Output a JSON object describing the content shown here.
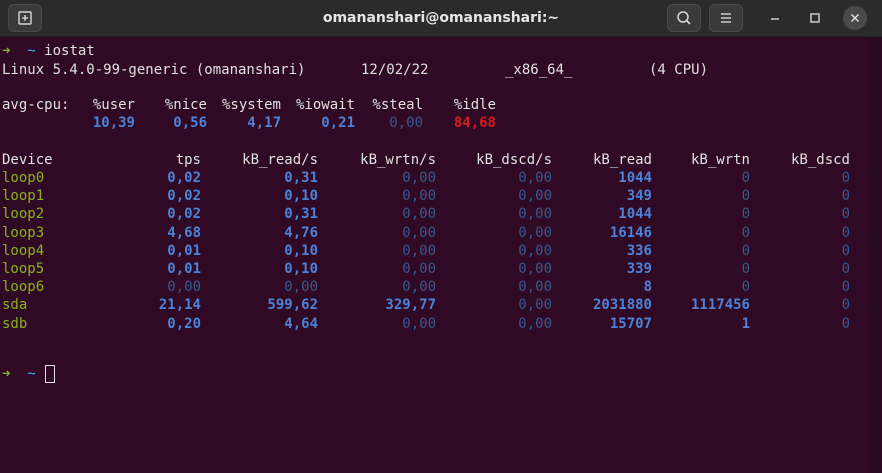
{
  "window": {
    "title": "omananshari@omananshari:~",
    "icons": [
      "new-tab-icon",
      "search-icon",
      "hamburger-menu-icon",
      "minimize-icon",
      "maximize-icon",
      "close-icon"
    ]
  },
  "terminal": {
    "prompt": {
      "arrow": "➜",
      "cwd": "~"
    },
    "command": "iostat",
    "sysinfo": {
      "kernel": "Linux 5.4.0-99-generic (omananshari)",
      "date": "12/02/22",
      "arch": "_x86_64_",
      "cpus": "(4 CPU)"
    },
    "cpu": {
      "label": "avg-cpu:",
      "headers": [
        "%user",
        "%nice",
        "%system",
        "%iowait",
        "%steal",
        "%idle"
      ],
      "values": [
        "10,39",
        "0,56",
        "4,17",
        "0,21",
        "0,00",
        "84,68"
      ]
    },
    "devices": {
      "headers": [
        "Device",
        "tps",
        "kB_read/s",
        "kB_wrtn/s",
        "kB_dscd/s",
        "kB_read",
        "kB_wrtn",
        "kB_dscd"
      ],
      "rows": [
        [
          "loop0",
          "0,02",
          "0,31",
          "0,00",
          "0,00",
          "1044",
          "0",
          "0"
        ],
        [
          "loop1",
          "0,02",
          "0,10",
          "0,00",
          "0,00",
          "349",
          "0",
          "0"
        ],
        [
          "loop2",
          "0,02",
          "0,31",
          "0,00",
          "0,00",
          "1044",
          "0",
          "0"
        ],
        [
          "loop3",
          "4,68",
          "4,76",
          "0,00",
          "0,00",
          "16146",
          "0",
          "0"
        ],
        [
          "loop4",
          "0,01",
          "0,10",
          "0,00",
          "0,00",
          "336",
          "0",
          "0"
        ],
        [
          "loop5",
          "0,01",
          "0,10",
          "0,00",
          "0,00",
          "339",
          "0",
          "0"
        ],
        [
          "loop6",
          "0,00",
          "0,00",
          "0,00",
          "0,00",
          "8",
          "0",
          "0"
        ],
        [
          "sda",
          "21,14",
          "599,62",
          "329,77",
          "0,00",
          "2031880",
          "1117456",
          "0"
        ],
        [
          "sdb",
          "0,20",
          "4,64",
          "0,00",
          "0,00",
          "15707",
          "1",
          "0"
        ]
      ]
    },
    "colors": {
      "background": "#300a24",
      "prompt_arrow": "#7fbf2a",
      "device_name": "#8ab21e",
      "number": "#4c82d8",
      "zero": "#35598f",
      "idle_value": "#d21d1d"
    }
  }
}
